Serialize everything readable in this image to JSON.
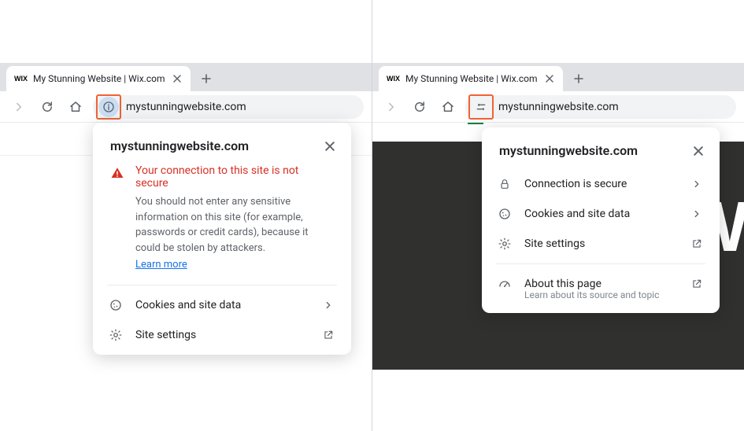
{
  "left": {
    "tab": {
      "favicon": "WIX",
      "title": "My Stunning Website | Wix.com"
    },
    "address": "mystunningwebsite.com",
    "popup": {
      "title": "mystunningwebsite.com",
      "warning_title": "Your connection to this site is not secure",
      "warning_desc": "You should not enter any sensitive information on this site (for example, passwords or credit cards), because it could be stolen by attackers.",
      "learn_more": "Learn more",
      "row_cookies": "Cookies and site data",
      "row_settings": "Site settings"
    }
  },
  "right": {
    "tab": {
      "favicon": "WIX",
      "title": "My Stunning Website | Wix.com"
    },
    "address": "mystunningwebsite.com",
    "popup": {
      "title": "mystunningwebsite.com",
      "row_secure": "Connection is secure",
      "row_cookies": "Cookies and site data",
      "row_settings": "Site settings",
      "row_about": "About this page",
      "about_sub": "Learn about its source and topic"
    }
  }
}
